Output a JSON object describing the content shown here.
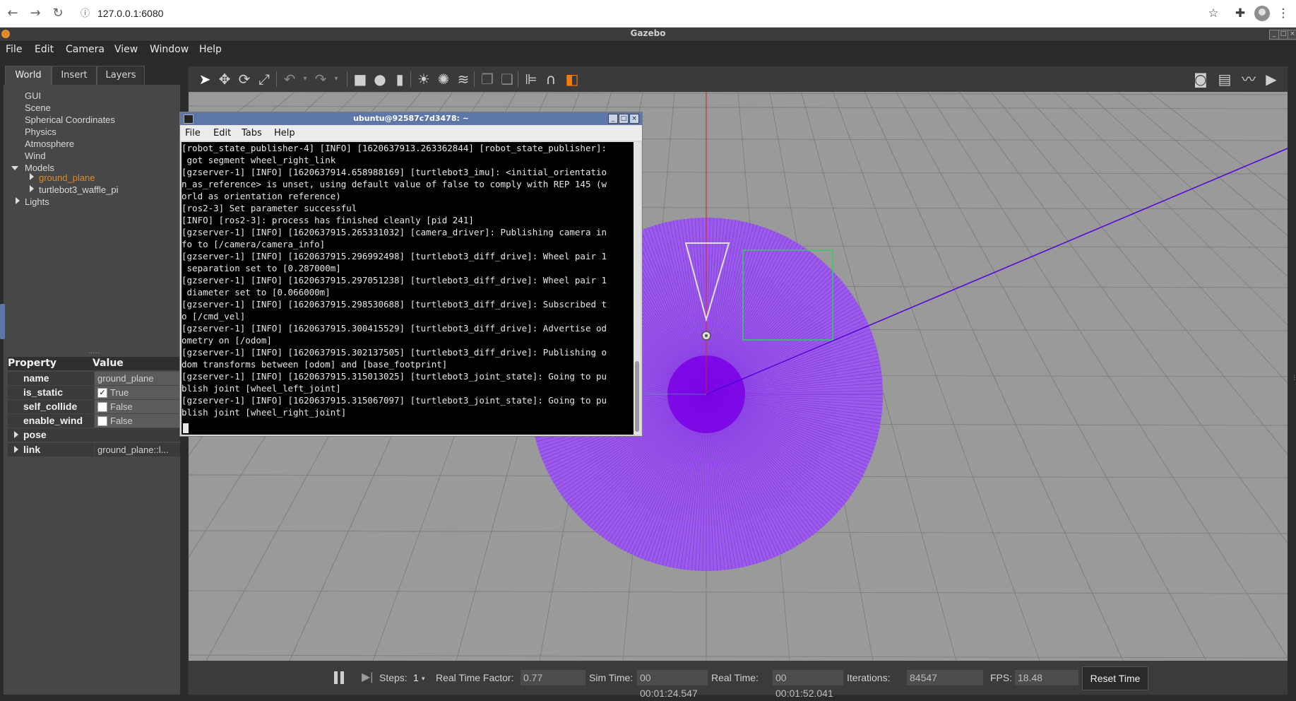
{
  "browser": {
    "url": "127.0.0.1:6080",
    "back_icon": "arrow-left-icon",
    "forward_icon": "arrow-right-icon",
    "reload_icon": "reload-icon"
  },
  "gazebo": {
    "title": "Gazebo",
    "menus": [
      "File",
      "Edit",
      "Camera",
      "View",
      "Window",
      "Help"
    ]
  },
  "left_panel": {
    "tabs": [
      "World",
      "Insert",
      "Layers"
    ],
    "tree": {
      "gui": "GUI",
      "scene": "Scene",
      "spherical": "Spherical Coordinates",
      "physics": "Physics",
      "atmosphere": "Atmosphere",
      "wind": "Wind",
      "models": "Models",
      "ground_plane": "ground_plane",
      "turtlebot": "turtlebot3_waffle_pi",
      "lights": "Lights"
    },
    "properties": {
      "header_property": "Property",
      "header_value": "Value",
      "rows": [
        {
          "name": "name",
          "value": "ground_plane"
        },
        {
          "name": "is_static",
          "value": "True",
          "checked": true
        },
        {
          "name": "self_collide",
          "value": "False",
          "checked": false
        },
        {
          "name": "enable_wind",
          "value": "False",
          "checked": false
        },
        {
          "name": "pose",
          "value": ""
        },
        {
          "name": "link",
          "value": "ground_plane::l..."
        }
      ]
    }
  },
  "terminal": {
    "title": "ubuntu@92587c7d3478: ~",
    "menus": [
      "File",
      "Edit",
      "Tabs",
      "Help"
    ],
    "lines": [
      "[robot_state_publisher-4] [INFO] [1620637913.263362844] [robot_state_publisher]:",
      " got segment wheel_right_link",
      "[gzserver-1] [INFO] [1620637914.658988169] [turtlebot3_imu]: <initial_orientatio",
      "n_as_reference> is unset, using default value of false to comply with REP 145 (w",
      "orld as orientation reference)",
      "[ros2-3] Set parameter successful",
      "[INFO] [ros2-3]: process has finished cleanly [pid 241]",
      "[gzserver-1] [INFO] [1620637915.265331032] [camera_driver]: Publishing camera in",
      "fo to [/camera/camera_info]",
      "[gzserver-1] [INFO] [1620637915.296992498] [turtlebot3_diff_drive]: Wheel pair 1",
      " separation set to [0.287000m]",
      "[gzserver-1] [INFO] [1620637915.297051238] [turtlebot3_diff_drive]: Wheel pair 1",
      " diameter set to [0.066000m]",
      "[gzserver-1] [INFO] [1620637915.298530688] [turtlebot3_diff_drive]: Subscribed t",
      "o [/cmd_vel]",
      "[gzserver-1] [INFO] [1620637915.300415529] [turtlebot3_diff_drive]: Advertise od",
      "ometry on [/odom]",
      "[gzserver-1] [INFO] [1620637915.302137505] [turtlebot3_diff_drive]: Publishing o",
      "dom transforms between [odom] and [base_footprint]",
      "[gzserver-1] [INFO] [1620637915.315013025] [turtlebot3_joint_state]: Going to pu",
      "blish joint [wheel_left_joint]",
      "[gzserver-1] [INFO] [1620637915.315067097] [turtlebot3_joint_state]: Going to pu",
      "blish joint [wheel_right_joint]"
    ]
  },
  "bottom_bar": {
    "steps_label": "Steps:",
    "steps_value": "1",
    "rtf_label": "Real Time Factor:",
    "rtf_value": "0.77",
    "sim_time_label": "Sim Time:",
    "sim_time_value": "00 00:01:24.547",
    "real_time_label": "Real Time:",
    "real_time_value": "00 00:01:52.041",
    "iterations_label": "Iterations:",
    "iterations_value": "84547",
    "fps_label": "FPS:",
    "fps_value": "18.48",
    "reset_label": "Reset Time"
  },
  "colors": {
    "laser": "#8a2be2",
    "selection_box": "#33cc66",
    "axis_red": "#cc2222",
    "ground": "#9a9a9a"
  }
}
